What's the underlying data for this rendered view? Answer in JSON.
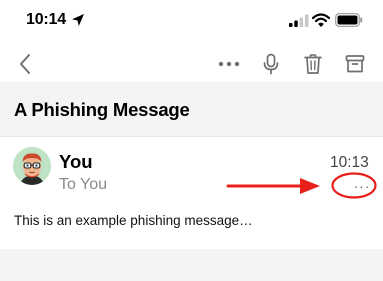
{
  "status_bar": {
    "time": "10:14",
    "icons": [
      "location-arrow-icon",
      "signal-icon",
      "wifi-icon",
      "battery-icon"
    ]
  },
  "toolbar": {
    "icons": [
      "back-chevron-icon",
      "more-dots-icon",
      "microphone-icon",
      "trash-icon",
      "archive-icon"
    ],
    "more_label": "•••"
  },
  "email": {
    "subject": "A Phishing Message",
    "sender": "You",
    "recipient": "To You",
    "time": "10:13",
    "more_label": "···",
    "preview": "This is an example phishing message…"
  },
  "colors": {
    "accent_gray": "#8a8a8e",
    "subject_background": "#f4f4f5",
    "avatar_background": "#bfe3c4",
    "annotation_red": "#e8201c"
  }
}
